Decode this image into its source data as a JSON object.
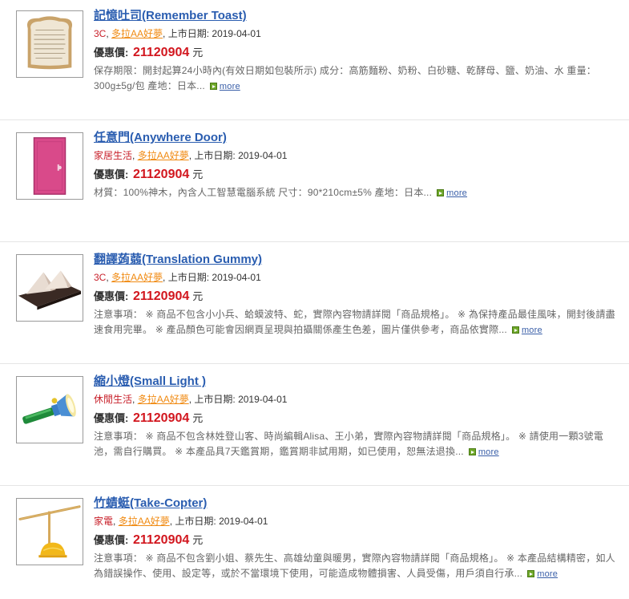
{
  "price_label": "優惠價:",
  "currency_unit": "元",
  "date_label": "上市日期:",
  "more_label": "more",
  "items": [
    {
      "title": "記憶吐司(Remember Toast)",
      "category": "3C",
      "brand": "多拉AA好夢",
      "date": "2019-04-01",
      "price": "21120904",
      "description": "保存期限：開封起算24小時內(有效日期如包裝所示) 成分：高筋麵粉、奶粉、白砂糖、乾酵母、鹽、奶油、水 重量：300g±5g/包 產地：日本...",
      "image_icon": "toast-image"
    },
    {
      "title": "任意門(Anywhere Door)",
      "category": "家居生活",
      "brand": "多拉AA好夢",
      "date": "2019-04-01",
      "price": "21120904",
      "description": "材質：100%神木，內含人工智慧電腦系統 尺寸：90*210cm±5% 產地：日本...",
      "image_icon": "door-image"
    },
    {
      "title": "翻譯蒟蒻(Translation Gummy)",
      "category": "3C",
      "brand": "多拉AA好夢",
      "date": "2019-04-01",
      "price": "21120904",
      "description": "注意事項： ※ 商品不包含小小兵、蛤蟆波特、蛇，實際內容物請詳閱「商品規格」。 ※ 為保持產品最佳風味，開封後請盡速食用完畢。 ※ 產品顏色可能會因網頁呈現與拍攝關係產生色差，圖片僅供參考，商品依實際...",
      "image_icon": "gummy-image"
    },
    {
      "title": "縮小燈(Small Light )",
      "category": "休閒生活",
      "brand": "多拉AA好夢",
      "date": "2019-04-01",
      "price": "21120904",
      "description": "注意事項： ※ 商品不包含林姓登山客、時尚編輯Alisa、王小弟，實際內容物請詳閱「商品規格」。 ※ 請使用一顆3號電池，需自行購買。 ※ 本產品具7天鑑賞期，鑑賞期非試用期，如已使用，恕無法退換...",
      "image_icon": "flashlight-image"
    },
    {
      "title": "竹蜻蜓(Take-Copter)",
      "category": "家電",
      "brand": "多拉AA好夢",
      "date": "2019-04-01",
      "price": "21120904",
      "description": "注意事項： ※ 商品不包含劉小姐、蔡先生、高雄幼童與暖男，實際內容物請詳閱「商品規格」。 ※ 本產品結構精密，如人為錯誤操作、使用、設定等，或於不當環境下使用，可能造成物體損害、人員受傷，用戶須自行承...",
      "image_icon": "copter-image"
    }
  ]
}
